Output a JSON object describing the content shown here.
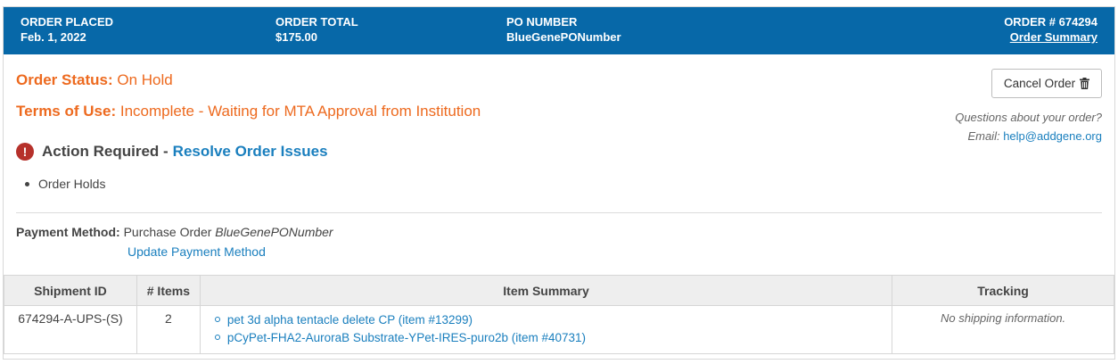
{
  "header": {
    "order_placed_label": "ORDER PLACED",
    "order_placed_value": "Feb. 1, 2022",
    "order_total_label": "ORDER TOTAL",
    "order_total_value": "$175.00",
    "po_label": "PO NUMBER",
    "po_value": "BlueGenePONumber",
    "order_num_label": "ORDER #",
    "order_num_value": "674294",
    "order_summary_link": "Order Summary"
  },
  "status": {
    "order_status_label": "Order Status:",
    "order_status_value": "On Hold",
    "terms_label": "Terms of Use:",
    "terms_value": "Incomplete - Waiting for MTA Approval from Institution"
  },
  "action": {
    "icon_glyph": "!",
    "title": "Action Required -",
    "link": "Resolve Order Issues",
    "holds": [
      "Order Holds"
    ]
  },
  "payment": {
    "label": "Payment Method:",
    "method": "Purchase Order",
    "po": "BlueGenePONumber",
    "update_link": "Update Payment Method"
  },
  "sidebar": {
    "cancel_label": "Cancel Order",
    "question": "Questions about your order?",
    "email_label": "Email:",
    "email": "help@addgene.org"
  },
  "table": {
    "headers": [
      "Shipment ID",
      "# Items",
      "Item Summary",
      "Tracking"
    ],
    "rows": [
      {
        "shipment_id": "674294-A-UPS-(S)",
        "count": "2",
        "items": [
          "pet 3d alpha tentacle delete CP (item #13299)",
          "pCyPet-FHA2-AuroraB Substrate-YPet-IRES-puro2b (item #40731)"
        ],
        "tracking": "No shipping information."
      }
    ]
  },
  "colors": {
    "header_bg": "#0768a8",
    "accent_orange": "#ed6a1f",
    "link_blue": "#1a7fbe",
    "alert_red": "#b6312b"
  },
  "icons": [
    "exclamation-circle-icon",
    "trash-icon",
    "bullet-icon"
  ]
}
